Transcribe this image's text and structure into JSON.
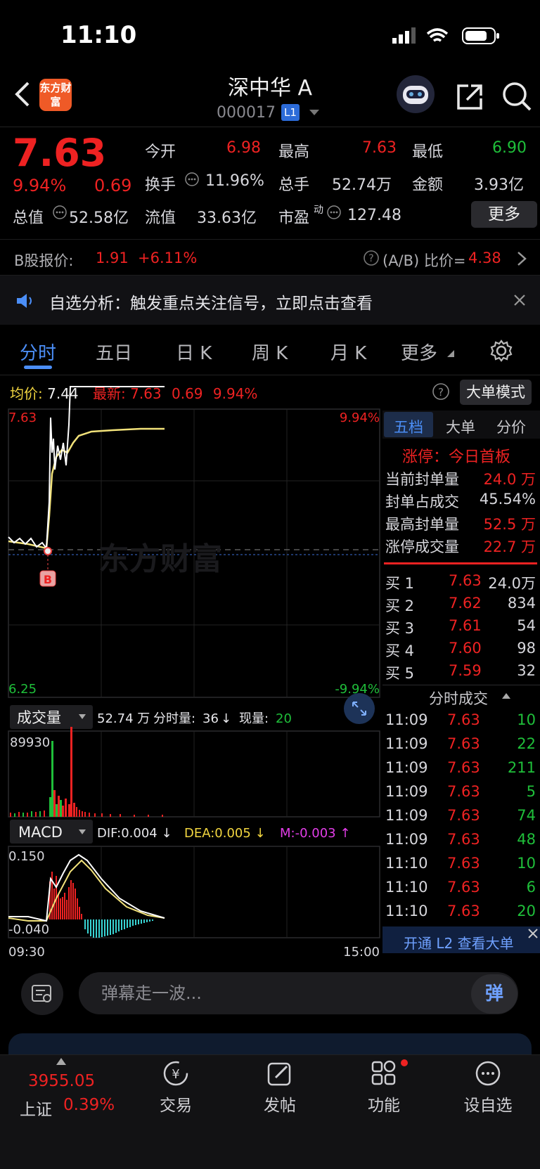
{
  "status_bar": {
    "time": "11:10"
  },
  "header": {
    "logo": "东方财富",
    "title": "深中华 A",
    "code": "000017",
    "level_badge": "L1"
  },
  "quote": {
    "price": "7.63",
    "change_pct": "9.94%",
    "change": "0.69",
    "open_label": "今开",
    "open": "6.98",
    "high_label": "最高",
    "high": "7.63",
    "low_label": "最低",
    "low": "6.90",
    "turnover_label": "换手",
    "turnover": "11.96%",
    "volume_label": "总手",
    "volume": "52.74万",
    "amount_label": "金额",
    "amount": "3.93亿",
    "mktcap_label": "总值",
    "mktcap": "52.58亿",
    "float_label": "流值",
    "float": "33.63亿",
    "pe_label": "市盈",
    "pe_sup": "动",
    "pe": "127.48",
    "more_label": "更多"
  },
  "bshare": {
    "label": "B股报价:",
    "price": "1.91",
    "pct": "+6.11%",
    "ratio_label": "(A/B) 比价=",
    "ratio": "4.38"
  },
  "notice": {
    "text": "自选分析：触发重点关注信号，立即点击查看"
  },
  "tabs": [
    "分时",
    "五日",
    "日 K",
    "周 K",
    "月 K",
    "更多"
  ],
  "chart_header": {
    "avg_label": "均价:",
    "avg": "7.44",
    "latest_label": "最新:",
    "latest": "7.63",
    "latest_chg": "0.69",
    "latest_pct": "9.94%",
    "mode_button": "大单模式"
  },
  "price_axis": {
    "top": "7.63",
    "bottom": "6.25",
    "top_pct": "9.94%",
    "bottom_pct": "-9.94%",
    "marker": "B",
    "watermark": "东方财富"
  },
  "volume_header": {
    "dropdown": "成交量",
    "total": "52.74 万",
    "minute_label": "分时量:",
    "minute": "36",
    "current_label": "现量:",
    "current": "20",
    "max": "89930"
  },
  "macd_header": {
    "dropdown": "MACD",
    "dif": "DIF:0.004 ↓",
    "dea": "DEA:0.005 ↓",
    "m": "M:-0.003 ↑",
    "top": "0.150",
    "bottom": "-0.040"
  },
  "time_axis": {
    "start": "09:30",
    "end": "15:00"
  },
  "right_panel": {
    "tabs": [
      "五档",
      "大单",
      "分价"
    ],
    "limit_title": "涨停：今日首板",
    "seal_stats": [
      {
        "label": "当前封单量",
        "value": "24.0 万"
      },
      {
        "label": "封单占成交",
        "value": "45.54%"
      },
      {
        "label": "最高封单量",
        "value": "52.5 万"
      },
      {
        "label": "涨停成交量",
        "value": "22.7 万"
      }
    ],
    "bids": [
      {
        "label": "买 1",
        "price": "7.63",
        "vol": "24.0万"
      },
      {
        "label": "买 2",
        "price": "7.62",
        "vol": "834"
      },
      {
        "label": "买 3",
        "price": "7.61",
        "vol": "54"
      },
      {
        "label": "买 4",
        "price": "7.60",
        "vol": "98"
      },
      {
        "label": "买 5",
        "price": "7.59",
        "vol": "32"
      }
    ],
    "trades_title": "分时成交",
    "trades": [
      {
        "time": "11:09",
        "price": "7.63",
        "vol": "10"
      },
      {
        "time": "11:09",
        "price": "7.63",
        "vol": "22"
      },
      {
        "time": "11:09",
        "price": "7.63",
        "vol": "211"
      },
      {
        "time": "11:09",
        "price": "7.63",
        "vol": "5"
      },
      {
        "time": "11:09",
        "price": "7.63",
        "vol": "74"
      },
      {
        "time": "11:09",
        "price": "7.63",
        "vol": "48"
      },
      {
        "time": "11:10",
        "price": "7.63",
        "vol": "10"
      },
      {
        "time": "11:10",
        "price": "7.63",
        "vol": "6"
      },
      {
        "time": "11:10",
        "price": "7.63",
        "vol": "20"
      }
    ],
    "l2_banner": "开通 L2 查看大单"
  },
  "danmu": {
    "placeholder": "弹幕走一波...",
    "send": "弹"
  },
  "bottom_nav": {
    "index_value": "3955.05",
    "index_name": "上证",
    "index_pct": "0.39%",
    "items": [
      "交易",
      "发帖",
      "功能",
      "设自选"
    ]
  },
  "colors": {
    "up": "#ee2222",
    "down": "#1fbf3a",
    "accent": "#4b8ef7",
    "price_line": "#ffffff",
    "avg_line": "#f2e27a"
  },
  "icons": [
    "back-arrow-icon",
    "robot-avatar-icon",
    "share-icon",
    "search-icon",
    "speaker-icon",
    "close-icon",
    "help-icon",
    "gear-icon",
    "expand-icon",
    "danmu-icon",
    "trade-icon",
    "post-icon",
    "function-icon",
    "watchlist-icon"
  ]
}
